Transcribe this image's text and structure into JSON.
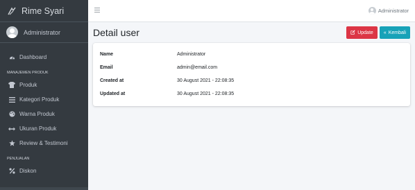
{
  "brand": {
    "name": "Rime Syari"
  },
  "sidebar": {
    "user_name": "Administrator",
    "items": [
      {
        "label": "Dashboard",
        "icon": "dashboard-icon"
      }
    ],
    "section_produk": "MANAJEMEN PRODUK",
    "produk_items": [
      {
        "label": "Produk",
        "icon": "shirt-icon"
      },
      {
        "label": "Kategori Produk",
        "icon": "list-icon"
      },
      {
        "label": "Warna Produk",
        "icon": "palette-icon"
      },
      {
        "label": "Ukuran Produk",
        "icon": "arrows-h-icon"
      },
      {
        "label": "Review & Testimoni",
        "icon": "star-icon"
      }
    ],
    "section_penjualan": "PENJUALAN",
    "penjualan_items": [
      {
        "label": "Diskon",
        "icon": "percent-icon"
      }
    ]
  },
  "topbar": {
    "user_name": "Administrator"
  },
  "page": {
    "title": "Detail user",
    "update_label": "Update",
    "kembali_label": "Kembali"
  },
  "detail": {
    "rows": [
      {
        "key": "Name",
        "value": "Administrator"
      },
      {
        "key": "Email",
        "value": "admin@email.com"
      },
      {
        "key": "Created at",
        "value": "30 August 2021 - 22:08:35"
      },
      {
        "key": "Updated at",
        "value": "30 August 2021 - 22:08:35"
      }
    ]
  },
  "colors": {
    "sidebar_bg": "#343a40",
    "update_btn": "#dc3545",
    "kembali_btn": "#17a2b8"
  }
}
